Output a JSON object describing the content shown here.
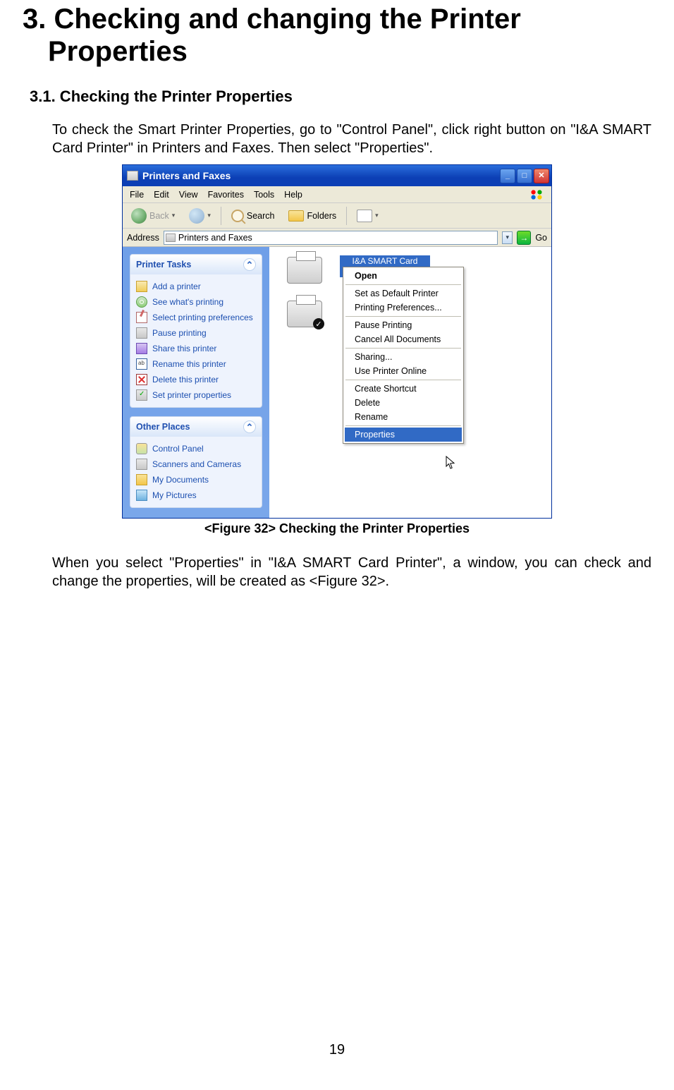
{
  "doc": {
    "h1": "3. Checking and changing the Printer Properties",
    "h2": "3.1. Checking the Printer Properties",
    "para1": "To check the Smart Printer Properties, go to \"Control Panel\", click right button on \"I&A SMART Card Printer\" in Printers and Faxes. Then select \"Properties\".",
    "caption": "<Figure 32> Checking the Printer Properties",
    "para2": "When you select \"Properties\" in \"I&A SMART Card Printer\", a window, you can check and change the properties, will be created as <Figure 32>.",
    "pagenum": "19"
  },
  "window": {
    "title": "Printers and Faxes",
    "menubar": [
      "File",
      "Edit",
      "View",
      "Favorites",
      "Tools",
      "Help"
    ],
    "toolbar": {
      "back": "Back",
      "search": "Search",
      "folders": "Folders"
    },
    "addressbar": {
      "label": "Address",
      "value": "Printers and Faxes",
      "go": "Go"
    },
    "sidepanel": {
      "printer_tasks": {
        "title": "Printer Tasks",
        "items": [
          "Add a printer",
          "See what's printing",
          "Select printing preferences",
          "Pause printing",
          "Share this printer",
          "Rename this printer",
          "Delete this printer",
          "Set printer properties"
        ]
      },
      "other_places": {
        "title": "Other Places",
        "items": [
          "Control Panel",
          "Scanners and Cameras",
          "My Documents",
          "My Pictures"
        ]
      }
    },
    "content": {
      "selected_printer_label": "I&A SMART Card Printer"
    },
    "context_menu": {
      "items": [
        {
          "label": "Open"
        },
        {
          "sep": true
        },
        {
          "label": "Set as Default Printer"
        },
        {
          "label": "Printing Preferences..."
        },
        {
          "sep": true
        },
        {
          "label": "Pause Printing"
        },
        {
          "label": "Cancel All Documents"
        },
        {
          "sep": true
        },
        {
          "label": "Sharing..."
        },
        {
          "label": "Use Printer Online"
        },
        {
          "sep": true
        },
        {
          "label": "Create Shortcut"
        },
        {
          "label": "Delete"
        },
        {
          "label": "Rename"
        },
        {
          "sep": true
        },
        {
          "label": "Properties"
        }
      ],
      "highlighted": "Properties"
    }
  }
}
